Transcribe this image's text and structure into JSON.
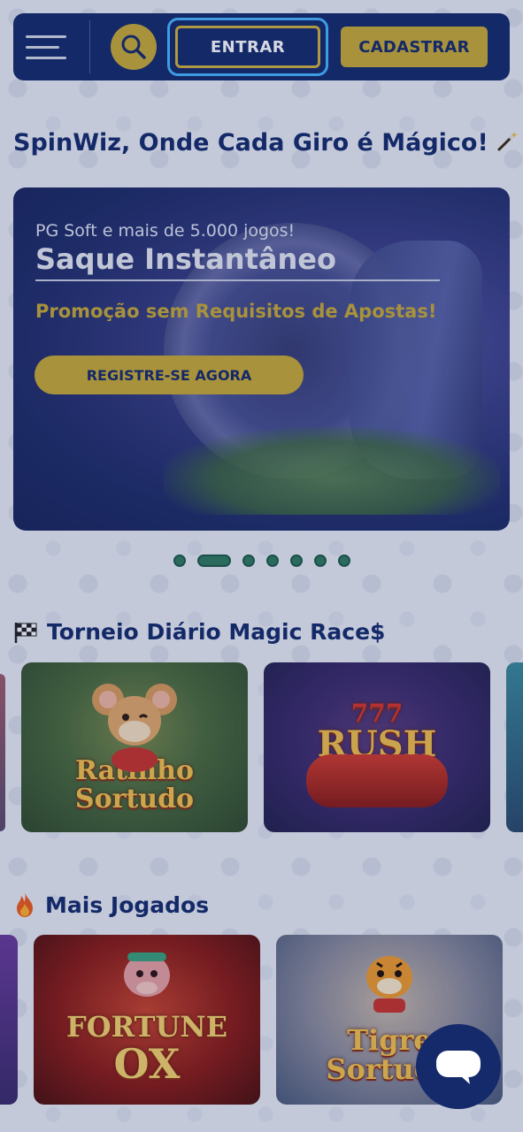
{
  "header": {
    "menu_icon": "hamburger-menu-icon",
    "search_icon": "search-icon",
    "login_label": "ENTRAR",
    "signup_label": "CADASTRAR"
  },
  "headline": {
    "text": "SpinWiz, Onde Cada Giro é Mágico!",
    "icon": "magic-wand-icon"
  },
  "banner": {
    "subtitle": "PG Soft e mais de 5.000 jogos!",
    "title": "Saque Instantâneo",
    "promo": "Promoção sem Requisitos de Apostas!",
    "cta_label": "REGISTRE-SE AGORA",
    "carousel_total": 7,
    "carousel_active_index": 1
  },
  "sections": [
    {
      "title": "Torneio Diário Magic Race$",
      "icon": "checkered-flag-icon",
      "games": [
        {
          "title_line1": "Ratinho",
          "title_line2": "Sortudo"
        },
        {
          "title_line1": "777",
          "title_line2": "RUSH"
        }
      ]
    },
    {
      "title": "Mais Jogados",
      "icon": "fire-icon",
      "games": [
        {
          "title_line1": "FORTUNE",
          "title_line2": "OX"
        },
        {
          "title_line1": "Tigre",
          "title_line2": "Sortudo"
        }
      ]
    }
  ],
  "chat": {
    "icon": "chat-bubble-icon"
  },
  "colors": {
    "navy": "#142a6b",
    "gold": "#c8aa35",
    "focus_blue": "#49b6ff",
    "dot_green": "#2f7a5e"
  }
}
